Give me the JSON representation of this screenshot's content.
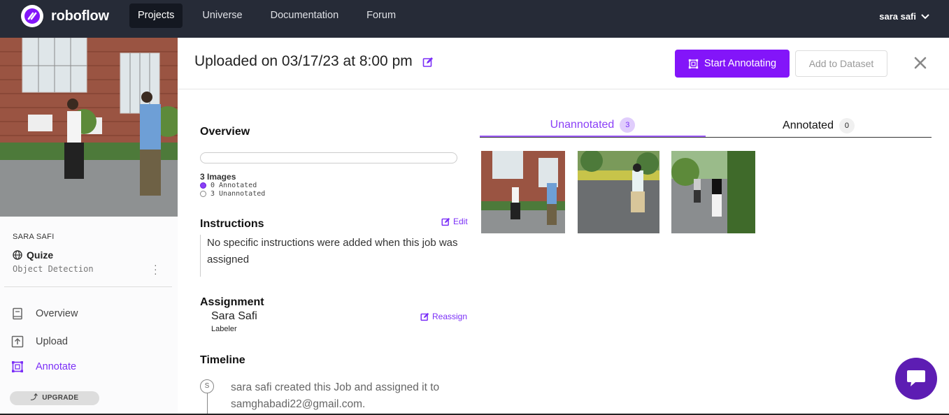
{
  "topbar": {
    "brand": "roboflow",
    "nav": [
      "Projects",
      "Universe",
      "Documentation",
      "Forum"
    ],
    "active_nav": "Projects",
    "user": "sara safi"
  },
  "sidebar": {
    "owner": "SARA SAFI",
    "project_name": "Quize",
    "project_type": "Object Detection",
    "nav": [
      {
        "label": "Overview",
        "icon": "book-icon"
      },
      {
        "label": "Upload",
        "icon": "upload-icon"
      },
      {
        "label": "Annotate",
        "icon": "annotate-icon",
        "active": true
      }
    ],
    "upgrade_label": "UPGRADE"
  },
  "header": {
    "title": "Uploaded on 03/17/23 at 8:00 pm",
    "start_button": "Start Annotating",
    "add_button": "Add to Dataset"
  },
  "overview": {
    "heading": "Overview",
    "progress_annotated_fraction": 0,
    "image_count": "3 Images",
    "annotated": "0 Annotated",
    "unannotated": "3 Unannotated"
  },
  "instructions": {
    "heading": "Instructions",
    "edit_label": "Edit",
    "text": "No specific instructions were added when this job was assigned"
  },
  "assignment": {
    "heading": "Assignment",
    "reassign_label": "Reassign",
    "name": "Sara Safi",
    "role": "Labeler"
  },
  "timeline": {
    "heading": "Timeline",
    "avatar_letter": "S",
    "entry": "sara safi created this Job and assigned it to samghabadi22@gmail.com."
  },
  "tabs": {
    "unannotated_label": "Unannotated",
    "unannotated_count": "3",
    "annotated_label": "Annotated",
    "annotated_count": "0"
  },
  "colors": {
    "accent": "#8315f9",
    "topbar": "#262b37",
    "chat": "#5d1db3"
  }
}
